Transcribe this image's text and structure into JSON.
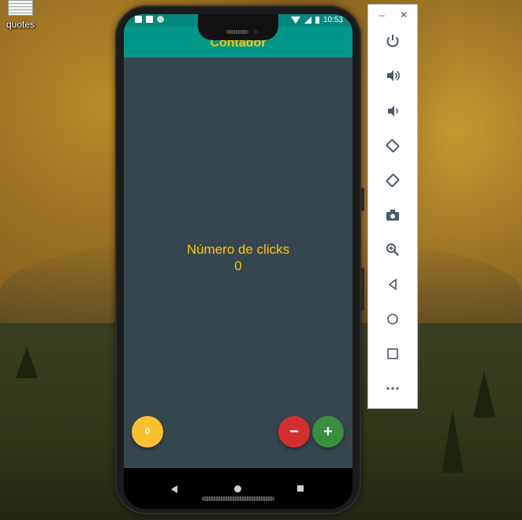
{
  "desktop": {
    "icon_label": "quotes",
    "icon_name": "text-file-icon"
  },
  "phone": {
    "status_bar": {
      "time": "10:53",
      "icons": [
        "app-notification-icon",
        "sd-card-icon",
        "circle-notification-icon",
        "wifi-icon",
        "signal-icon",
        "battery-icon"
      ]
    },
    "app_bar": {
      "title": "Contador"
    },
    "body": {
      "label": "Número de clicks",
      "count": "0"
    },
    "fabs": {
      "counter_label": "0",
      "minus_label": "−",
      "plus_label": "+"
    },
    "colors": {
      "app_bar": "#009688",
      "background": "#36474f",
      "accent_text": "#ffc107",
      "fab_counter": "#fbc02d",
      "fab_minus": "#d32f2f",
      "fab_plus": "#388e3c"
    }
  },
  "emulator_toolbar": {
    "window_controls": [
      "minimize-icon",
      "close-icon"
    ],
    "minimize_label": "–",
    "close_label": "✕",
    "buttons": [
      {
        "name": "power-icon"
      },
      {
        "name": "volume-up-icon"
      },
      {
        "name": "volume-down-icon"
      },
      {
        "name": "rotate-left-icon"
      },
      {
        "name": "rotate-right-icon"
      },
      {
        "name": "screenshot-camera-icon"
      },
      {
        "name": "zoom-icon"
      },
      {
        "name": "back-icon"
      },
      {
        "name": "home-icon"
      },
      {
        "name": "overview-icon"
      },
      {
        "name": "more-options-icon"
      }
    ]
  }
}
